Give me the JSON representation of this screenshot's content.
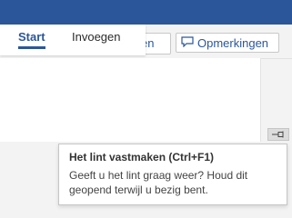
{
  "tabs": [
    {
      "label": "Start"
    },
    {
      "label": "Invoegen"
    }
  ],
  "toolbar": {
    "partial_button_label": "en",
    "comments_label": "Opmerkingen"
  },
  "icons": {
    "comments": "speech-bubble-icon",
    "pin": "pin-icon"
  },
  "colors": {
    "accent": "#2b579a"
  },
  "tooltip": {
    "title": "Het lint vastmaken (Ctrl+F1)",
    "body": "Geeft u het lint graag weer? Houd dit geopend terwijl u bezig bent."
  }
}
